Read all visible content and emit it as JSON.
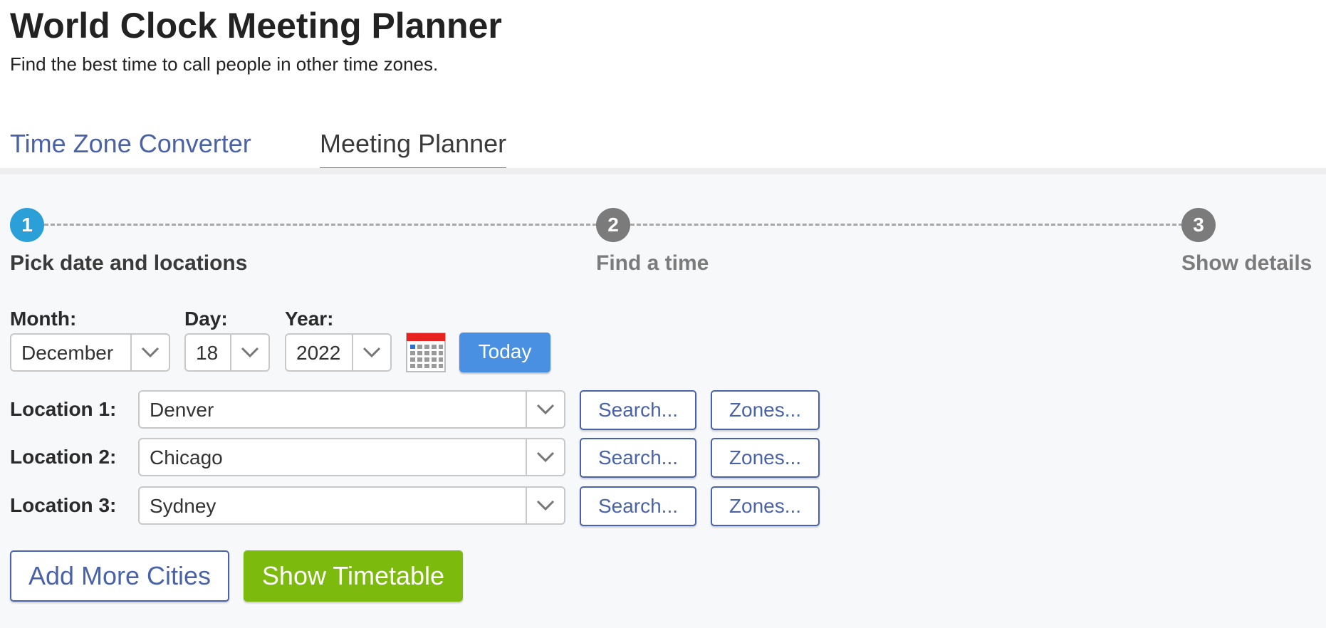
{
  "header": {
    "title": "World Clock Meeting Planner",
    "subtitle": "Find the best time to call people in other time zones."
  },
  "tabs": [
    {
      "label": "Time Zone Converter",
      "active": false
    },
    {
      "label": "Meeting Planner",
      "active": true
    }
  ],
  "steps": [
    {
      "number": "1",
      "label": "Pick date and locations",
      "active": true
    },
    {
      "number": "2",
      "label": "Find a time",
      "active": false
    },
    {
      "number": "3",
      "label": "Show details",
      "active": false
    }
  ],
  "date": {
    "month_label": "Month:",
    "month_value": "December",
    "day_label": "Day:",
    "day_value": "18",
    "year_label": "Year:",
    "year_value": "2022",
    "calendar_icon": "calendar-icon",
    "today_label": "Today"
  },
  "locations": [
    {
      "label": "Location 1:",
      "value": "Denver",
      "search_label": "Search...",
      "zones_label": "Zones..."
    },
    {
      "label": "Location 2:",
      "value": "Chicago",
      "search_label": "Search...",
      "zones_label": "Zones..."
    },
    {
      "label": "Location 3:",
      "value": "Sydney",
      "search_label": "Search...",
      "zones_label": "Zones..."
    }
  ],
  "actions": {
    "add_more_label": "Add More Cities",
    "show_timetable_label": "Show Timetable"
  },
  "colors": {
    "link_blue": "#4a63a8",
    "accent_blue": "#4a90e2",
    "step_active": "#2a9fd8",
    "step_inactive": "#7b7b7b",
    "primary_green": "#7cba0e"
  }
}
